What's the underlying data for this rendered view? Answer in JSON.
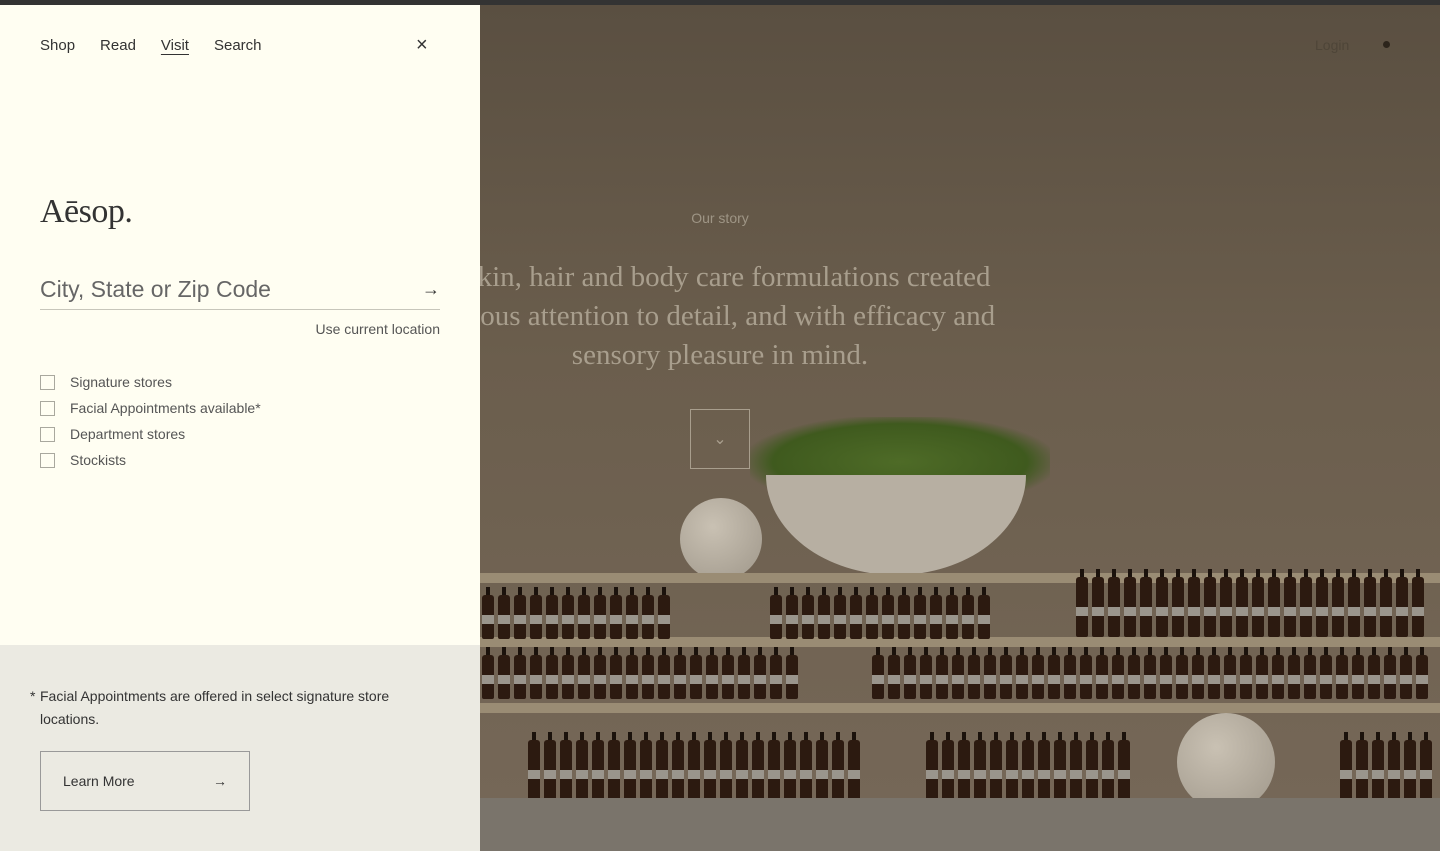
{
  "drawer": {
    "nav": [
      {
        "label": "Shop"
      },
      {
        "label": "Read"
      },
      {
        "label": "Visit"
      },
      {
        "label": "Search"
      }
    ],
    "close_icon": "×",
    "logo": "Aēsop.",
    "search": {
      "placeholder": "City, State or Zip Code",
      "submit_icon": "→"
    },
    "use_location": "Use current location",
    "filters": [
      {
        "label": "Signature stores",
        "checked": false
      },
      {
        "label": "Facial Appointments available*",
        "checked": false
      },
      {
        "label": "Department stores",
        "checked": false
      },
      {
        "label": "Stockists",
        "checked": false
      }
    ],
    "footnote": {
      "marker": "*",
      "text": "Facial Appointments are offered in select signature store locations."
    },
    "learn_more": {
      "label": "Learn More",
      "icon": "→"
    }
  },
  "background": {
    "login": "Login",
    "eyebrow": "Our story",
    "hero_text": "r skin, hair and body care formulations created culous attention to detail, and with efficacy and sensory pleasure in mind.",
    "scroll_icon": "⌄"
  }
}
